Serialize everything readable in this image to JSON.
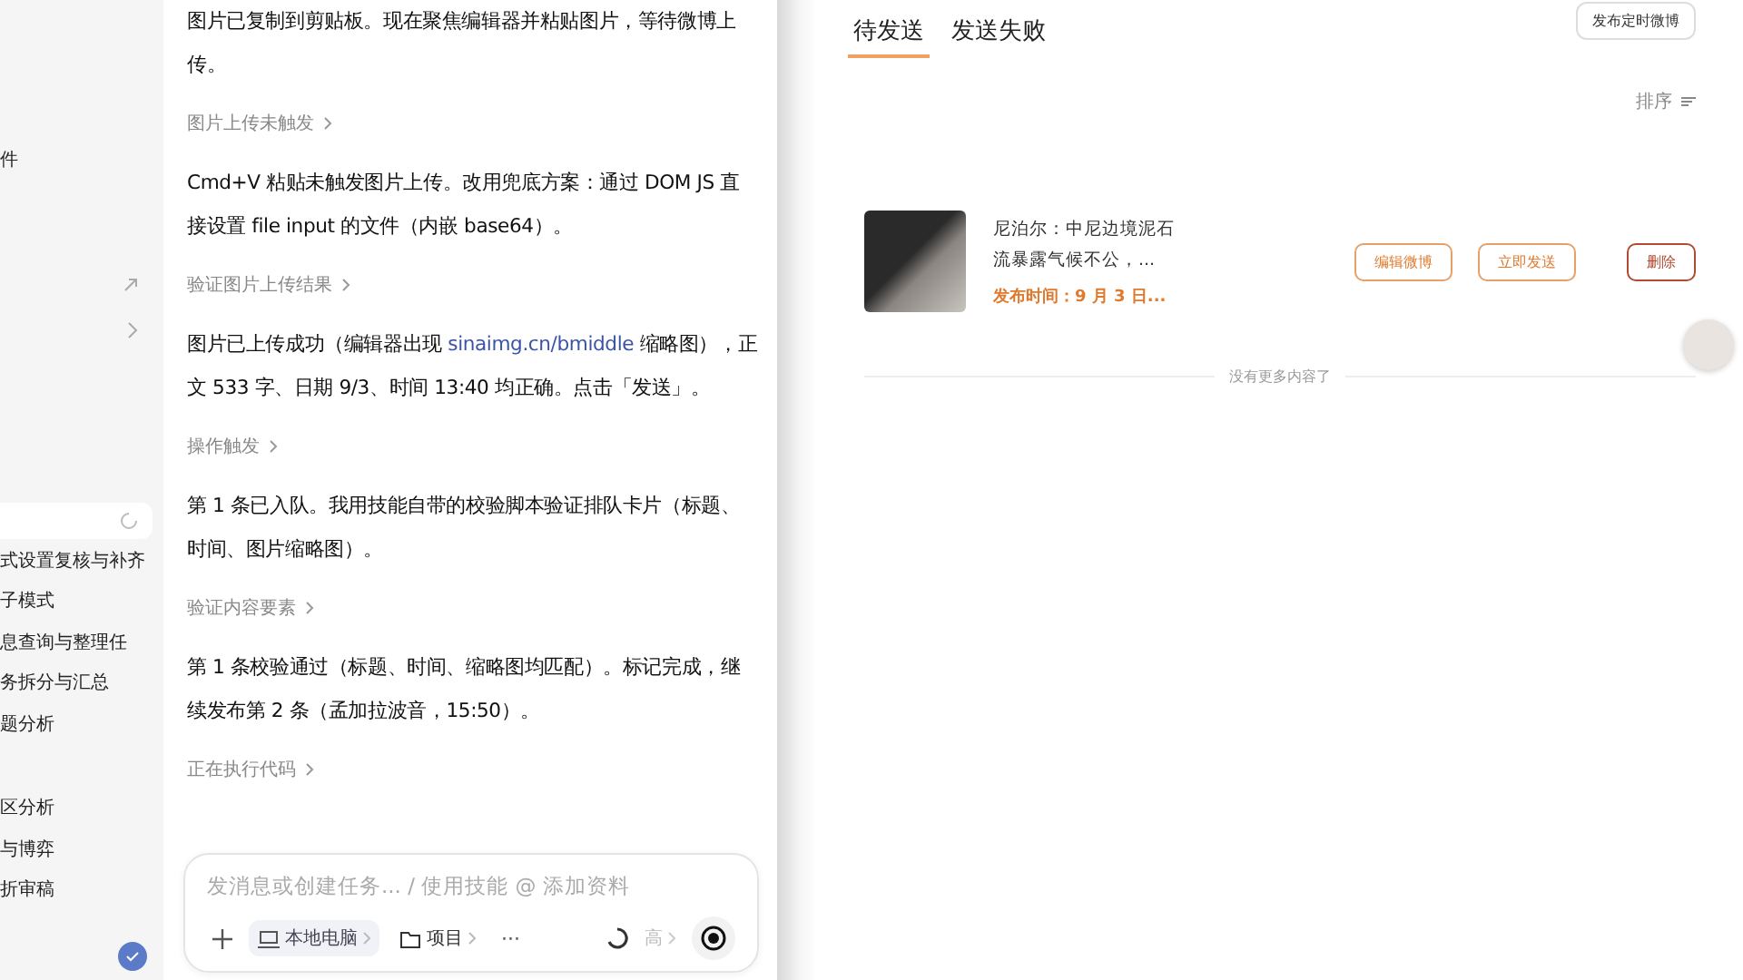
{
  "sidebar": {
    "top_item": "件",
    "groups": [
      [
        "式设置复核与补齐",
        "子模式",
        "息查询与整理任",
        "务拆分与汇总",
        "题分析"
      ],
      [
        "区分析",
        "与博弈",
        "折审稿"
      ]
    ]
  },
  "chat": {
    "messages": [
      {
        "kind": "text",
        "text": "图片已复制到剪贴板。现在聚焦编辑器并粘贴图片，等待微博上传。"
      },
      {
        "kind": "step",
        "text": "图片上传未触发"
      },
      {
        "kind": "text",
        "text": "Cmd+V 粘贴未触发图片上传。改用兜底方案：通过 DOM JS 直接设置 file input 的文件（内嵌 base64）。"
      },
      {
        "kind": "step",
        "text": "验证图片上传结果"
      },
      {
        "kind": "text",
        "before": "图片已上传成功（编辑器出现 ",
        "link": "sinaimg.cn/bmiddle",
        "text": " 缩略图），正文 533 字、日期 9/3、时间 13:40 均正确。点击「发送」。"
      },
      {
        "kind": "step",
        "text": "操作触发"
      },
      {
        "kind": "text",
        "text": "第 1 条已入队。我用技能自带的校验脚本验证排队卡片（标题、时间、图片缩略图）。"
      },
      {
        "kind": "step",
        "text": "验证内容要素"
      },
      {
        "kind": "text",
        "text": "第 1 条校验通过（标题、时间、缩略图均匹配）。标记完成，继续发布第 2 条（孟加拉波音，15:50）。"
      },
      {
        "kind": "step",
        "text": "正在执行代码"
      }
    ],
    "composer": {
      "placeholder": "发消息或创建任务... / 使用技能 @ 添加资料",
      "chips": [
        {
          "kind": "computer",
          "label": "本地电脑",
          "selected": true
        },
        {
          "kind": "folder",
          "label": "项目",
          "selected": false
        }
      ],
      "more": "···",
      "level_label": "高"
    }
  },
  "weibo": {
    "tabs": [
      {
        "label": "待发送",
        "selected": true
      },
      {
        "label": "发送失败",
        "selected": false
      }
    ],
    "schedule_button": "发布定时微博",
    "sort": "排序",
    "posts": [
      {
        "title": "尼泊尔：中尼边境泥石流暴露气候不公，...",
        "time": "发布时间：9 月 3 日...",
        "actions": [
          {
            "kind": "edit",
            "label": "编辑微博"
          },
          {
            "kind": "send",
            "label": "立即发送"
          },
          {
            "kind": "delete",
            "label": "删除"
          }
        ]
      }
    ],
    "end_note": "没有更多内容了"
  }
}
